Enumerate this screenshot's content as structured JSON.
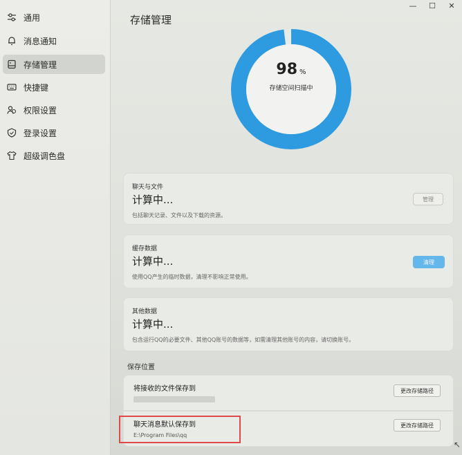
{
  "window": {
    "minimize": "—",
    "maximize": "☐",
    "close": "✕"
  },
  "sidebar": {
    "items": [
      {
        "label": "通用",
        "icon": "sliders-icon"
      },
      {
        "label": "消息通知",
        "icon": "bell-icon"
      },
      {
        "label": "存储管理",
        "icon": "storage-icon",
        "active": true
      },
      {
        "label": "快捷键",
        "icon": "keyboard-icon"
      },
      {
        "label": "权限设置",
        "icon": "users-icon"
      },
      {
        "label": "登录设置",
        "icon": "shield-icon"
      },
      {
        "label": "超级调色盘",
        "icon": "shirt-icon"
      }
    ]
  },
  "main": {
    "title": "存储管理",
    "progress": {
      "value": "98",
      "unit": "%",
      "label": "存储空间扫描中",
      "fraction": 0.98
    },
    "cards": [
      {
        "title": "聊天与文件",
        "value": "计算中...",
        "desc": "包括聊天记录、文件以及下载的资源。",
        "button": "管理"
      },
      {
        "title": "缓存数据",
        "value": "计算中...",
        "desc": "使用QQ产生的临时数据，清理不影响正常使用。",
        "button": "清理"
      },
      {
        "title": "其他数据",
        "value": "计算中...",
        "desc": "包含运行QQ的必要文件、其他QQ账号的数据等，如需清理其他账号的内容，请切换账号。"
      }
    ],
    "save_location": {
      "section_title": "保存位置",
      "rows": [
        {
          "title": "将接收的文件保存到",
          "path": "",
          "button": "更改存储路径"
        },
        {
          "title": "聊天消息默认保存到",
          "path": "E:\\Program Files\\qq",
          "button": "更改存储路径"
        }
      ]
    }
  },
  "colors": {
    "accent": "#64b7ea",
    "ring": "#2e9be0",
    "ring_track": "#e8eae6",
    "highlight": "#e0484a"
  }
}
